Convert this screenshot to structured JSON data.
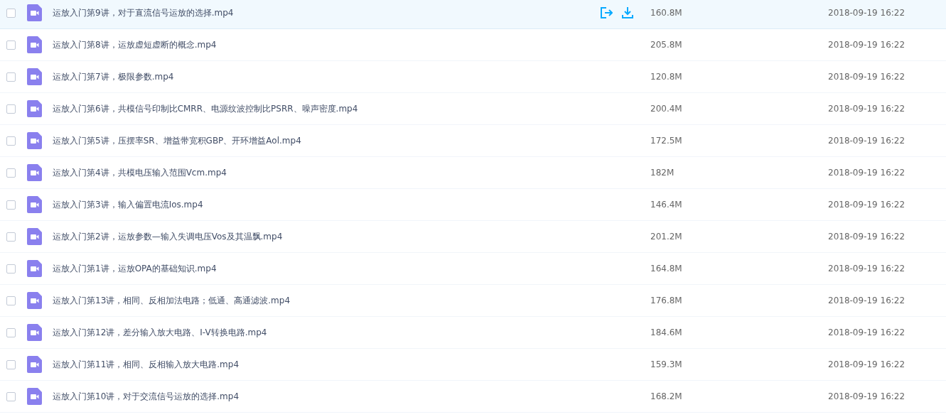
{
  "files": [
    {
      "name": "运放入门第9讲，对于直流信号运放的选择.mp4",
      "size": "160.8M",
      "modified": "2018-09-19 16:22",
      "checked": false,
      "highlighted": true
    },
    {
      "name": "运放入门第8讲，运放虚短虚断的概念.mp4",
      "size": "205.8M",
      "modified": "2018-09-19 16:22",
      "checked": false,
      "highlighted": false
    },
    {
      "name": "运放入门第7讲，极限参数.mp4",
      "size": "120.8M",
      "modified": "2018-09-19 16:22",
      "checked": false,
      "highlighted": false
    },
    {
      "name": "运放入门第6讲，共模信号印制比CMRR、电源纹波控制比PSRR、噪声密度.mp4",
      "size": "200.4M",
      "modified": "2018-09-19 16:22",
      "checked": false,
      "highlighted": false
    },
    {
      "name": "运放入门第5讲，压摆率SR、增益带宽积GBP、开环增益Aol.mp4",
      "size": "172.5M",
      "modified": "2018-09-19 16:22",
      "checked": false,
      "highlighted": false
    },
    {
      "name": "运放入门第4讲，共模电压输入范围Vcm.mp4",
      "size": "182M",
      "modified": "2018-09-19 16:22",
      "checked": false,
      "highlighted": false
    },
    {
      "name": "运放入门第3讲，输入偏置电流Ios.mp4",
      "size": "146.4M",
      "modified": "2018-09-19 16:22",
      "checked": false,
      "highlighted": false
    },
    {
      "name": "运放入门第2讲，运放参数—输入失调电压Vos及其温飘.mp4",
      "size": "201.2M",
      "modified": "2018-09-19 16:22",
      "checked": false,
      "highlighted": false
    },
    {
      "name": "运放入门第1讲，运放OPA的基础知识.mp4",
      "size": "164.8M",
      "modified": "2018-09-19 16:22",
      "checked": false,
      "highlighted": false
    },
    {
      "name": "运放入门第13讲，相同、反相加法电路；低通、高通滤波.mp4",
      "size": "176.8M",
      "modified": "2018-09-19 16:22",
      "checked": false,
      "highlighted": false
    },
    {
      "name": "运放入门第12讲，差分输入放大电路、I-V转换电路.mp4",
      "size": "184.6M",
      "modified": "2018-09-19 16:22",
      "checked": false,
      "highlighted": false
    },
    {
      "name": "运放入门第11讲，相同、反相输入放大电路.mp4",
      "size": "159.3M",
      "modified": "2018-09-19 16:22",
      "checked": false,
      "highlighted": false
    },
    {
      "name": "运放入门第10讲，对于交流信号运放的选择.mp4",
      "size": "168.2M",
      "modified": "2018-09-19 16:22",
      "checked": false,
      "highlighted": false
    }
  ]
}
